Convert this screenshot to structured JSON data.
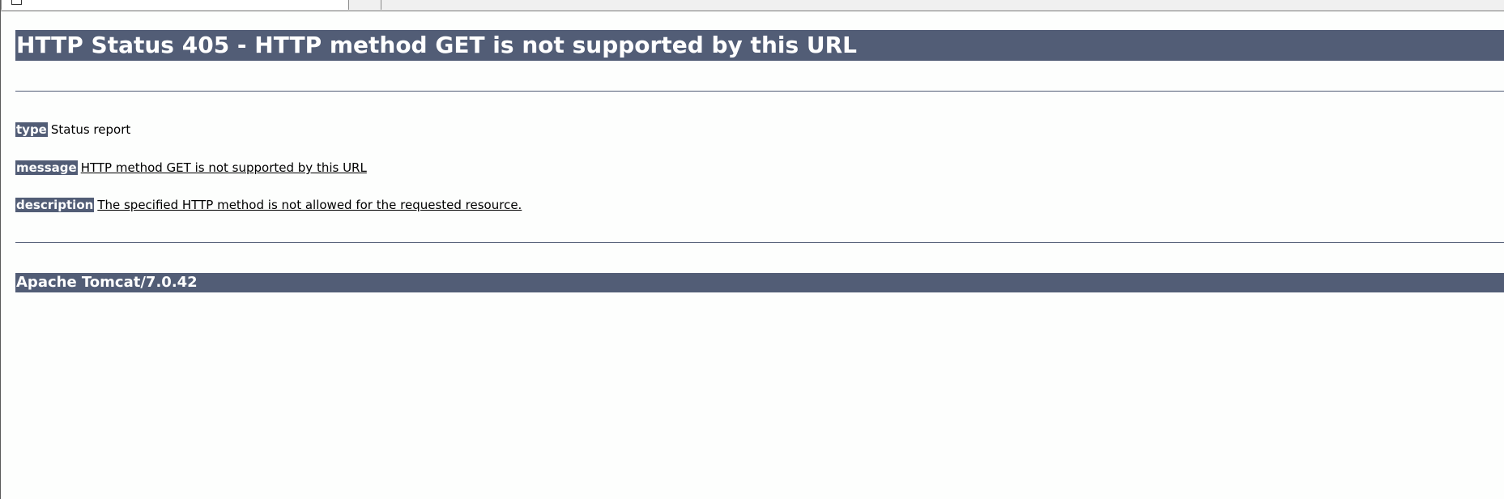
{
  "browser": {
    "tab_title": ""
  },
  "page": {
    "heading": "HTTP Status 405 - HTTP method GET is not supported by this URL",
    "fields": [
      {
        "label": "type",
        "value": "Status report"
      },
      {
        "label": "message",
        "value": "HTTP method GET is not supported by this URL"
      },
      {
        "label": "description",
        "value": "The specified HTTP method is not allowed for the requested resource."
      }
    ],
    "footer": "Apache Tomcat/7.0.42"
  },
  "colors": {
    "accent": "#525d76",
    "background": "#ffffff",
    "text": "#000000"
  },
  "icons": {
    "tab_icon": "page-icon"
  }
}
